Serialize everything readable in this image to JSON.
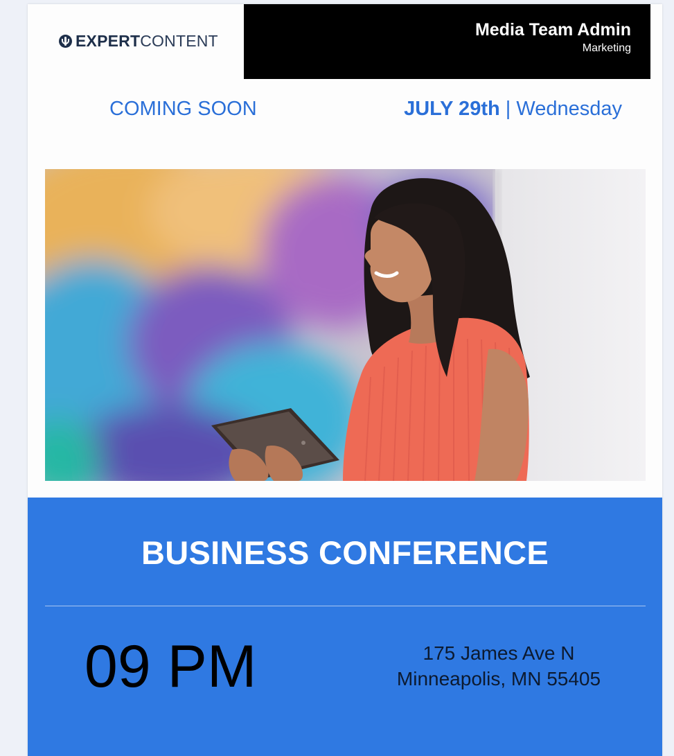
{
  "header": {
    "brand_strong": "EXPERT",
    "brand_light": "CONTENT",
    "user_name": "Media Team Admin",
    "user_role": "Marketing"
  },
  "subheader": {
    "coming_soon": "COMING SOON",
    "date_strong": "JULY 29th",
    "date_separator": "|",
    "weekday": "Wednesday"
  },
  "event": {
    "title": "BUSINESS CONFERENCE",
    "time": "09 PM",
    "address_line1": "175 James Ave N",
    "address_line2": "Minneapolis, MN 55405"
  },
  "colors": {
    "accent_blue": "#2f79e2",
    "text_blue": "#2a6fd8",
    "header_black": "#000000",
    "brand_navy": "#1e2f4a"
  },
  "icons": {
    "brand": "expert-content-logo-icon"
  }
}
